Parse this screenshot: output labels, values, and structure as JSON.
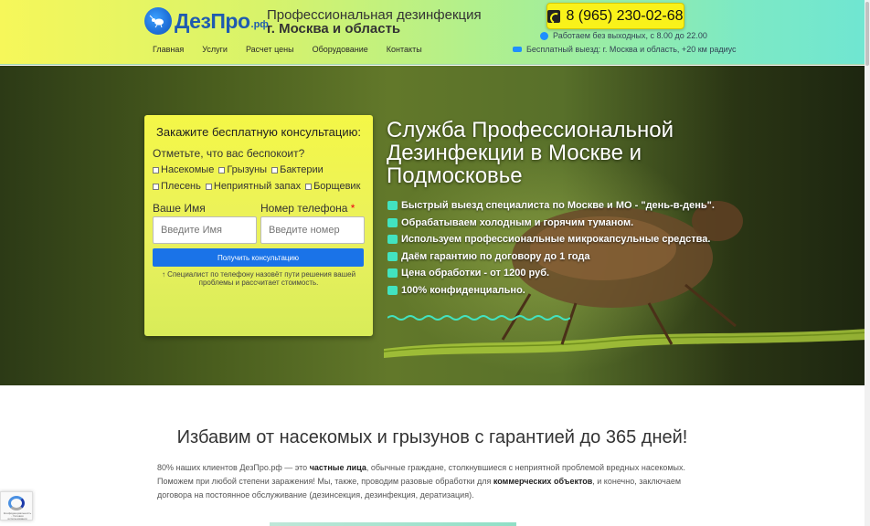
{
  "header": {
    "logo_text": "ДезПро",
    "logo_tld": ".рф",
    "tagline_line1": "Профессиональная дезинфекция",
    "tagline_line2": "г. Москва и область",
    "phone": "8 (965) 230-02-68",
    "hours": "Работаем без выходных, с 8.00 до 22.00",
    "free_visit": "Бесплатный выезд: г. Москва и область, +20 км радиус"
  },
  "nav": {
    "items": [
      "Главная",
      "Услуги",
      "Расчет цены",
      "Оборудование",
      "Контакты"
    ]
  },
  "form": {
    "title": "Закажите бесплатную консультацию:",
    "question": "Отметьте, что вас беспокоит?",
    "options": [
      "Насекомые",
      "Грызуны",
      "Бактерии",
      "Плесень",
      "Неприятный запах",
      "Борщевик"
    ],
    "name_label": "Ваше Имя",
    "name_placeholder": "Введите Имя",
    "phone_label": "Номер телефона",
    "phone_required": "*",
    "phone_placeholder": "Введите номер",
    "submit": "Получить консультацию",
    "note": "↑ Специалист по телефону назовёт пути решения вашей проблемы и рассчитает стоимость."
  },
  "hero": {
    "title": "Служба Профессиональной Дезинфекции в Москве и Подмосковье",
    "features": [
      "Быстрый выезд специалиста по Москве и МО - \"день-в-день\".",
      "Обрабатываем холодным и горячим туманом.",
      "Используем профессиональные микрокапсульные средства.",
      "Даём гарантию по договору до 1 года",
      "Цена обработки - от 1200 руб.",
      "100% конфиденциально."
    ]
  },
  "section": {
    "title": "Избавим от насекомых и грызунов с гарантией до 365 дней!",
    "text_1": "80% наших клиентов ДезПро.рф — это ",
    "text_bold_1": "частные лица",
    "text_2": ", обычные граждане, столкнувшиеся с неприятной проблемой вредных насекомых. Поможем при любой степени заражения! Мы, также, проводим разовые обработки для ",
    "text_bold_2": "коммерческих объектов",
    "text_3": ", и конечно, заключаем договора на постоянное обслуживание (дезинсекция, дезинфекция, дератизация)."
  },
  "recaptcha": {
    "text": "Конфиденциальность - Условия использования"
  },
  "colors": {
    "accent": "#1a73e8",
    "phone_button": "#f9f21a",
    "feature_icon": "#42e3c0"
  }
}
